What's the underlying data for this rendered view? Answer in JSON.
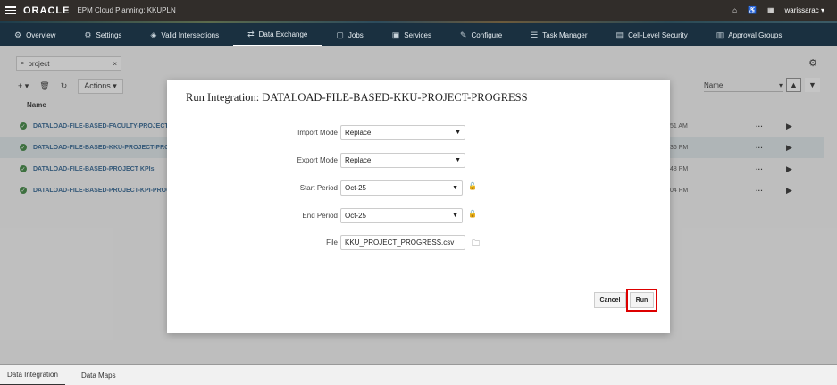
{
  "topbar": {
    "logo": "ORACLE",
    "app_title": "EPM Cloud Planning: KKUPLN",
    "user": "warissarac"
  },
  "nav": {
    "items": [
      {
        "label": "Overview",
        "icon": "overview-icon"
      },
      {
        "label": "Settings",
        "icon": "settings-icon"
      },
      {
        "label": "Valid Intersections",
        "icon": "valid-intersections-icon"
      },
      {
        "label": "Data Exchange",
        "icon": "data-exchange-icon"
      },
      {
        "label": "Jobs",
        "icon": "jobs-icon"
      },
      {
        "label": "Services",
        "icon": "services-icon"
      },
      {
        "label": "Configure",
        "icon": "configure-icon"
      },
      {
        "label": "Task Manager",
        "icon": "task-manager-icon"
      },
      {
        "label": "Cell-Level Security",
        "icon": "cell-security-icon"
      },
      {
        "label": "Approval Groups",
        "icon": "approval-groups-icon"
      }
    ],
    "active": "Data Exchange"
  },
  "list": {
    "search_value": "project",
    "actions_label": "Actions",
    "sort_field": "Name",
    "column_header": "Name",
    "rows": [
      {
        "name": "DATALOAD-FILE-BASED-FACULTY-PROJECT-PRO",
        "time": "51 AM"
      },
      {
        "name": "DATALOAD-FILE-BASED-KKU-PROJECT-PROGRE",
        "time": "36 PM"
      },
      {
        "name": "DATALOAD-FILE-BASED-PROJECT KPIs",
        "time": "48 PM"
      },
      {
        "name": "DATALOAD-FILE-BASED-PROJECT-KPI-PROGRES",
        "time": "04 PM"
      }
    ]
  },
  "dialog": {
    "title": "Run Integration: DATALOAD-FILE-BASED-KKU-PROJECT-PROGRESS",
    "fields": {
      "import_mode": {
        "label": "Import Mode",
        "value": "Replace"
      },
      "export_mode": {
        "label": "Export Mode",
        "value": "Replace"
      },
      "start_period": {
        "label": "Start Period",
        "value": "Oct-25"
      },
      "end_period": {
        "label": "End Period",
        "value": "Oct-25"
      },
      "file": {
        "label": "File",
        "value": "KKU_PROJECT_PROGRESS.csv"
      }
    },
    "cancel_label": "Cancel",
    "run_label": "Run"
  },
  "bottom_tabs": [
    "Data Integration",
    "Data Maps"
  ],
  "colors": {
    "highlight": "#dd0000",
    "nav_bg": "#1a3040",
    "topbar_bg": "#312d2a",
    "link": "#225a8a",
    "success": "#2e7d32"
  }
}
